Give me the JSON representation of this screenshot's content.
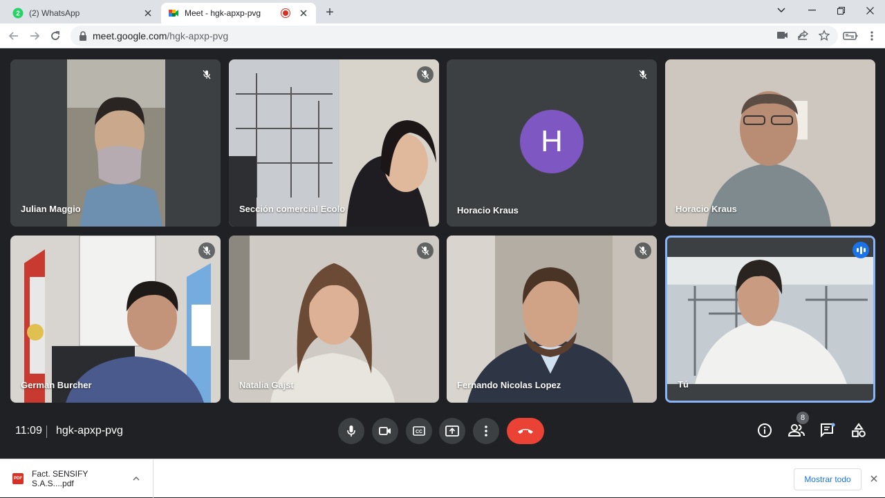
{
  "browser": {
    "tabs": [
      {
        "title": "(2) WhatsApp",
        "badge": "2",
        "active": false
      },
      {
        "title": "Meet - hgk-apxp-pvg",
        "active": true,
        "recording": true
      }
    ],
    "url_host": "meet.google.com",
    "url_path": "/hgk-apxp-pvg",
    "icons": {
      "new_tab": "+",
      "min": "minimize-icon",
      "max": "restore-icon",
      "close": "close-icon"
    }
  },
  "meeting": {
    "time": "11:09",
    "code": "hgk-apxp-pvg",
    "participant_count": "8",
    "tiles": [
      {
        "name": "Julian Maggio",
        "muted": true,
        "video_bg": "#8f8a7e"
      },
      {
        "name": "Sección comercial Ecolo",
        "muted": true,
        "video_bg": "#a8a49c"
      },
      {
        "name": "Horacio Kraus",
        "muted": true,
        "avatar_letter": "H",
        "avatar_color": "#7e57c2"
      },
      {
        "name": "Horacio Kraus",
        "muted": false,
        "video_bg": "#b9b0a4"
      },
      {
        "name": "German Burcher",
        "muted": true,
        "video_bg": "#c9c4bd"
      },
      {
        "name": "Natalia Gajst",
        "muted": true,
        "video_bg": "#cfcbc4"
      },
      {
        "name": "Fernando Nicolas Lopez",
        "muted": true,
        "video_bg": "#9a938a"
      },
      {
        "name": "Tú",
        "muted": false,
        "speaking": true,
        "video_bg": "#c4cbd1"
      }
    ]
  },
  "downloads": {
    "file_name": "Fact. SENSIFY S.A.S....pdf",
    "file_type": "PDF",
    "show_all": "Mostrar todo"
  },
  "colors": {
    "meet_bg": "#202124",
    "tile_bg": "#3c4043",
    "hangup": "#ea4335",
    "accent": "#1a73e8",
    "self_border": "#8ab4f8"
  }
}
